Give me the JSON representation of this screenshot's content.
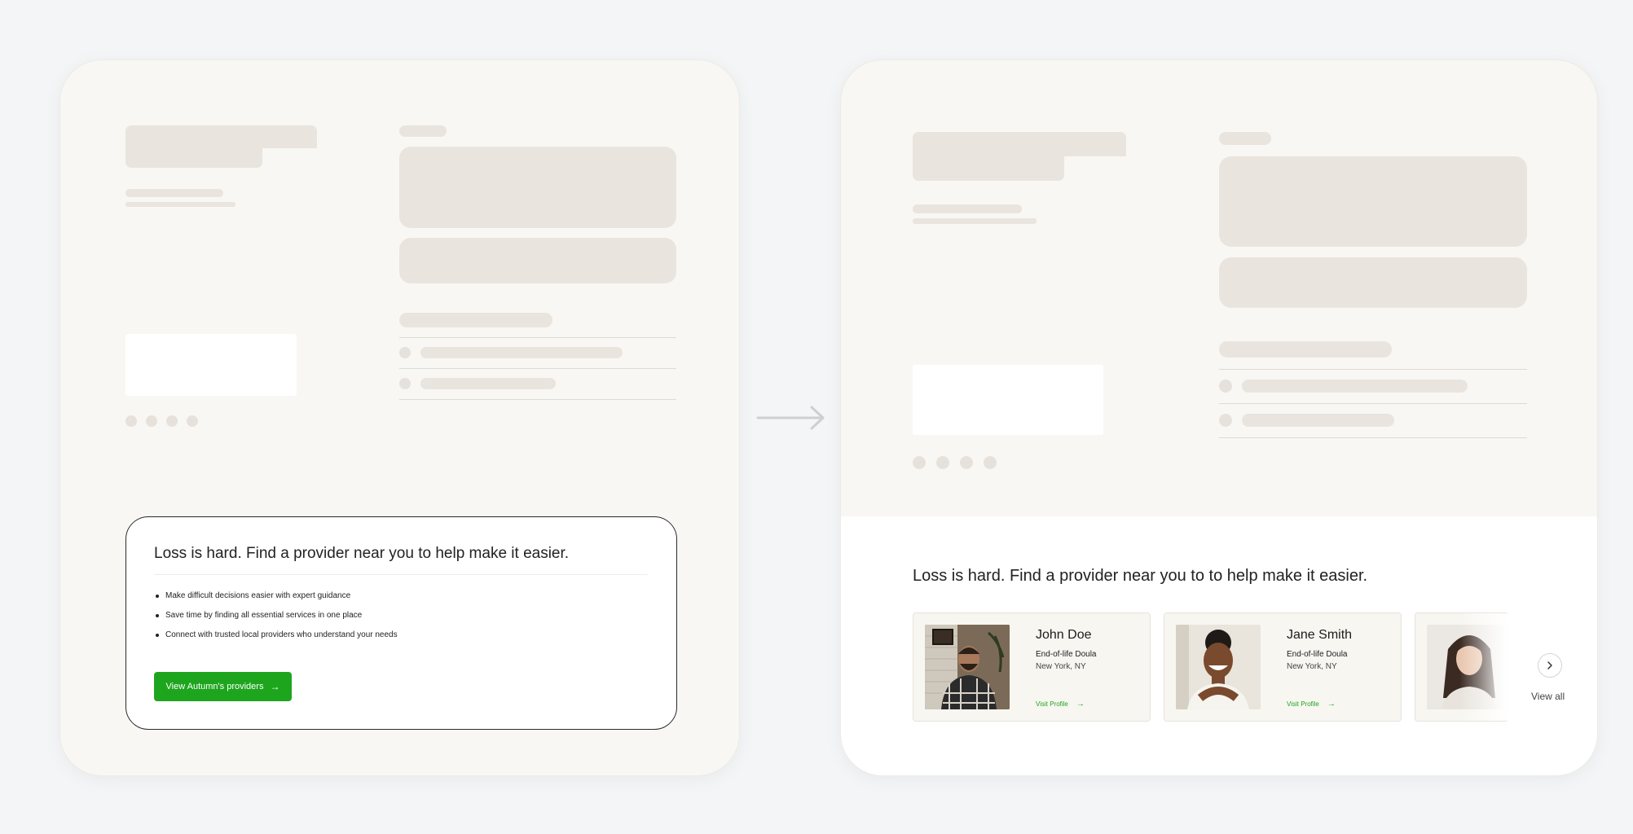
{
  "before": {
    "card": {
      "heading": "Loss is hard. Find a provider near you to help make it easier.",
      "bullets": [
        "Make difficult decisions easier with expert guidance",
        "Save time by finding all essential services in one place",
        "Connect with trusted local providers who understand your needs"
      ],
      "cta_label": "View Autumn's providers",
      "cta_icon": "arrow-right-icon"
    }
  },
  "after": {
    "heading": "Loss is hard. Find a provider near you to to help make it easier.",
    "providers": [
      {
        "name": "John Doe",
        "role": "End-of-life Doula",
        "location": "New York, NY",
        "link": "Visit Profile"
      },
      {
        "name": "Jane Smith",
        "role": "End-of-life Doula",
        "location": "New York, NY",
        "link": "Visit Profile"
      }
    ],
    "next_icon": "chevron-right-icon",
    "view_all": "View all"
  },
  "colors": {
    "panel_bg": "#f8f7f3",
    "placeholder": "#e9e5de",
    "accent_green": "#1ea51e",
    "page_bg": "#f4f5f7"
  }
}
